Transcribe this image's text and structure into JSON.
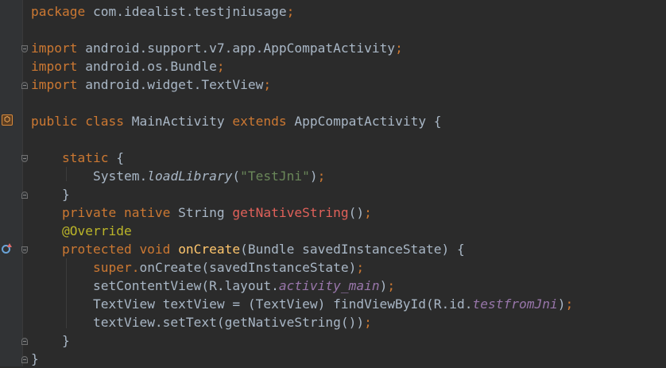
{
  "editor": {
    "language": "java",
    "colors": {
      "background": "#2b2b2b",
      "gutter": "#313335",
      "text": "#a9b7c6",
      "keyword": "#cc7832",
      "string": "#6a8759",
      "annotation": "#bbb529",
      "method_decl": "#ffc66d",
      "native_method": "#e0615a",
      "static_field": "#9876aa"
    },
    "gutter_icons": [
      "class-implementation-icon",
      "override-method-icon"
    ]
  },
  "code": {
    "l1": {
      "kw": "package",
      "rest": " com.idealist.testjniusage",
      "semi": ";"
    },
    "l3": {
      "kw": "import",
      "rest": " android.support.v7.app.AppCompatActivity",
      "semi": ";"
    },
    "l4": {
      "kw": "import",
      "rest": " android.os.Bundle",
      "semi": ";"
    },
    "l5": {
      "kw": "import",
      "rest": " android.widget.TextView",
      "semi": ";"
    },
    "l7": {
      "kw1": "public class",
      "name": " MainActivity ",
      "kw2": "extends",
      "rest": " AppCompatActivity {"
    },
    "l9": {
      "kw": "static",
      "rest": " {"
    },
    "l10": {
      "obj": "System.",
      "method": "loadLibrary",
      "open": "(",
      "str": "\"TestJni\"",
      "close": ")",
      "semi": ";"
    },
    "l11": {
      "text": "}"
    },
    "l12": {
      "kw": "private native",
      "type": " String ",
      "method": "getNativeString",
      "tail": "()",
      "semi": ";"
    },
    "l13": {
      "ann": "@Override"
    },
    "l14": {
      "kw": "protected void",
      "sp": " ",
      "method": "onCreate",
      "rest": "(Bundle savedInstanceState) {"
    },
    "l15": {
      "kw": "super",
      "dot": ".",
      "rest": "onCreate(savedInstanceState)",
      "semi": ";"
    },
    "l16": {
      "pre": "setContentView(R.layout.",
      "field": "activity_main",
      "post": ")",
      "semi": ";"
    },
    "l17": {
      "pre": "TextView textView = (TextView) findViewById(R.id.",
      "field": "testfromJni",
      "post": ")",
      "semi": ";"
    },
    "l18": {
      "pre": "textView.setText(getNativeString())",
      "semi": ";"
    },
    "l19": {
      "text": "}"
    },
    "l20": {
      "text": "}"
    }
  }
}
